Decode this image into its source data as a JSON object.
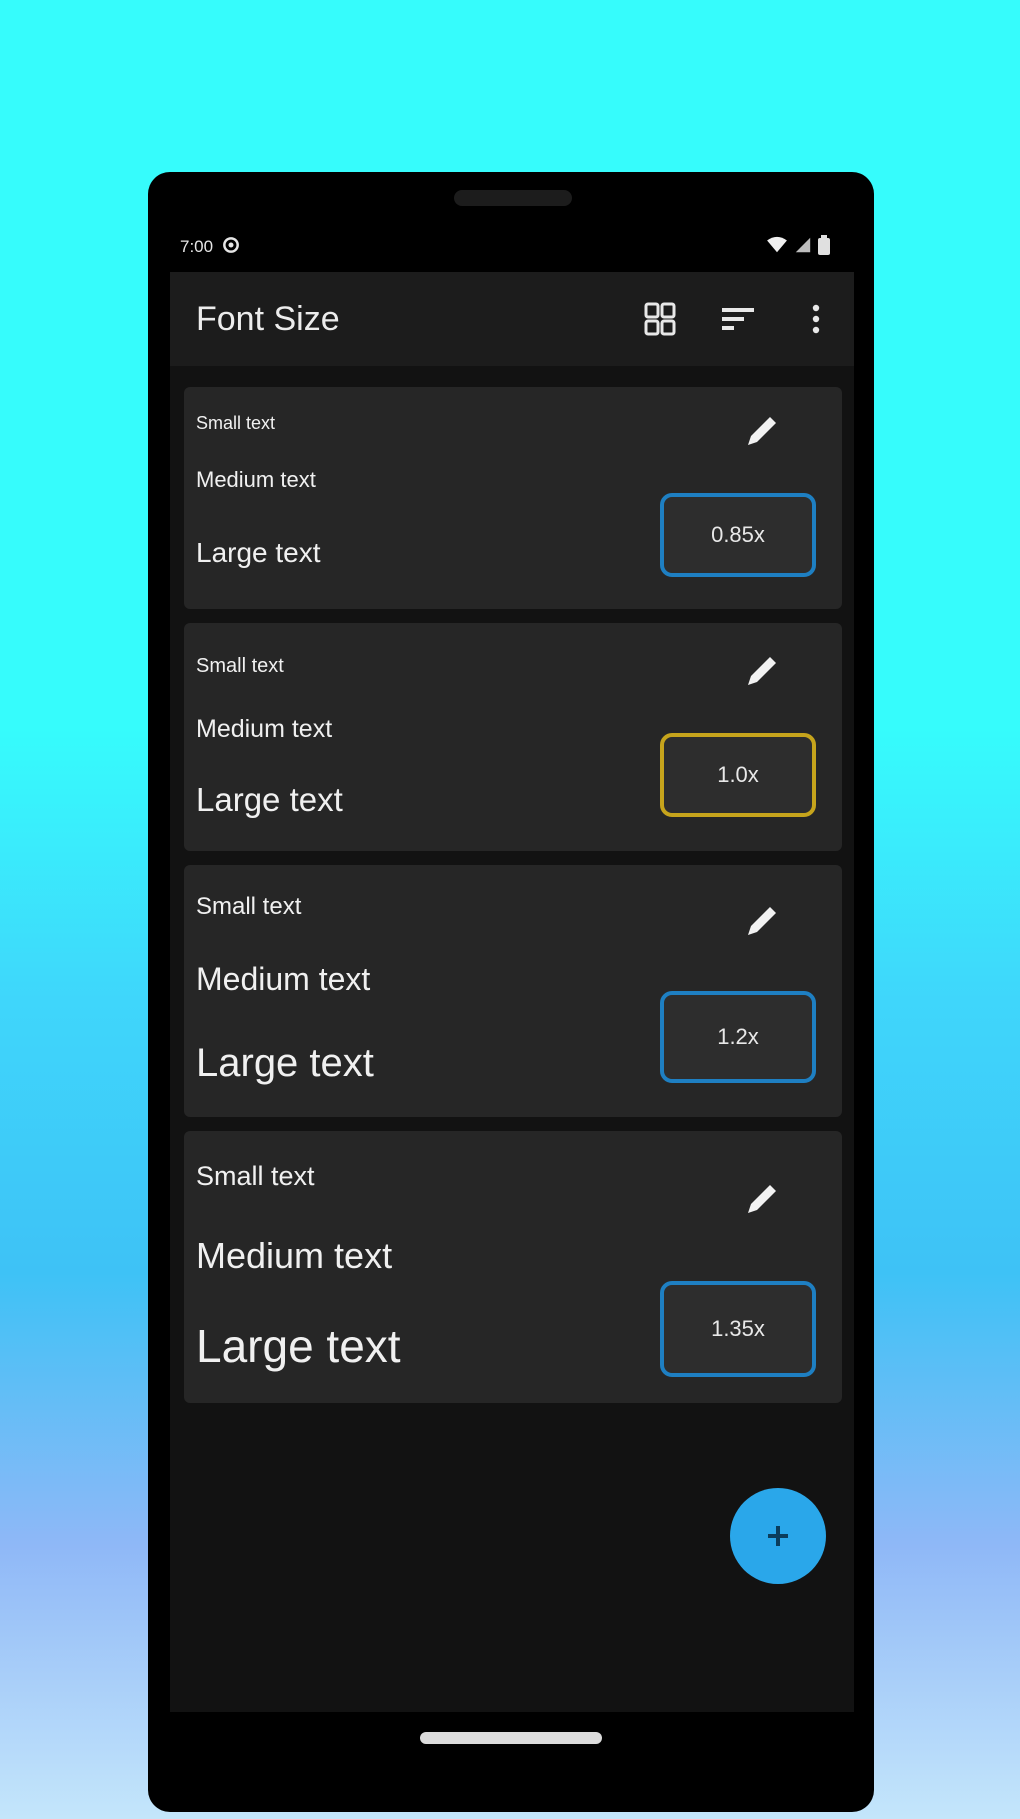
{
  "status_bar": {
    "time": "7:00"
  },
  "app_bar": {
    "title": "Font Size"
  },
  "cards": [
    {
      "small": "Small text",
      "medium": "Medium text",
      "large": "Large text",
      "scale": "0.85x",
      "selected": false
    },
    {
      "small": "Small text",
      "medium": "Medium text",
      "large": "Large text",
      "scale": "1.0x",
      "selected": true
    },
    {
      "small": "Small text",
      "medium": "Medium text",
      "large": "Large text",
      "scale": "1.2x",
      "selected": false
    },
    {
      "small": "Small text",
      "medium": "Medium text",
      "large": "Large text",
      "scale": "1.35x",
      "selected": false
    }
  ],
  "fab": {
    "icon": "plus-icon"
  },
  "colors": {
    "background_top": "#36fcfc",
    "screen": "#121212",
    "card": "#262626",
    "chip_border": "#1e7fc2",
    "chip_selected_border": "#c6a41c",
    "fab": "#2aa7ea"
  }
}
